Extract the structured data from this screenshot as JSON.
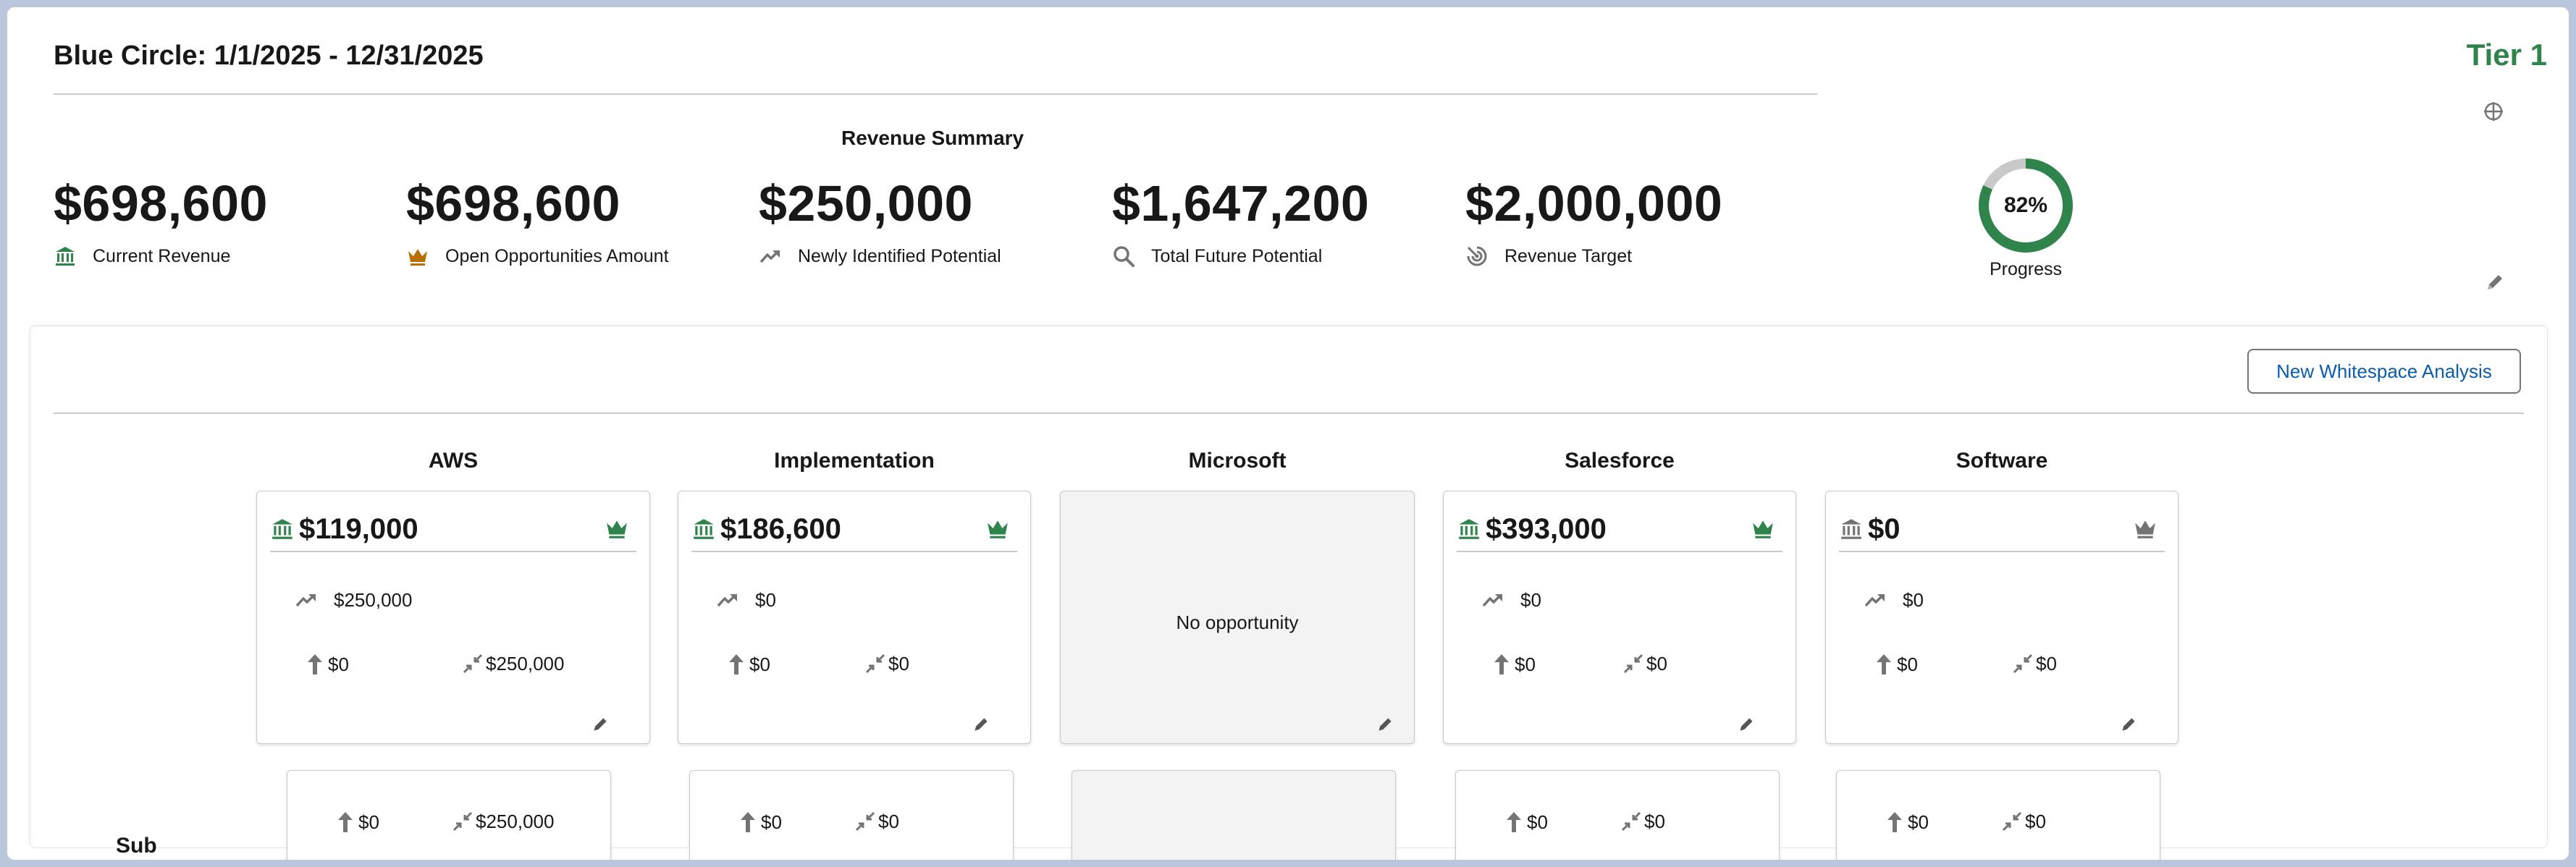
{
  "header": {
    "title": "Blue Circle: 1/1/2025 - 12/31/2025",
    "tier": "Tier 1"
  },
  "summary": {
    "heading": "Revenue Summary",
    "metrics": [
      {
        "amount": "$698,600",
        "label": "Current Revenue",
        "icon": "bank-icon"
      },
      {
        "amount": "$698,600",
        "label": "Open Opportunities Amount",
        "icon": "crown-icon"
      },
      {
        "amount": "$250,000",
        "label": "Newly Identified Potential",
        "icon": "trend-up-icon"
      },
      {
        "amount": "$1,647,200",
        "label": "Total Future Potential",
        "icon": "search-icon"
      },
      {
        "amount": "$2,000,000",
        "label": "Revenue Target",
        "icon": "target-icon"
      }
    ],
    "progress": {
      "percent_text": "82%",
      "value": 0.82,
      "label": "Progress"
    }
  },
  "whitespace": {
    "new_button": "New Whitespace Analysis",
    "columns": [
      {
        "title": "AWS",
        "revenue": "$119,000",
        "potential": "$250,000",
        "upsell": "$0",
        "cross": "$250,000",
        "has_opportunity": true,
        "row2_upsell": "$0",
        "row2_cross": "$250,000"
      },
      {
        "title": "Implementation",
        "revenue": "$186,600",
        "potential": "$0",
        "upsell": "$0",
        "cross": "$0",
        "has_opportunity": true,
        "row2_upsell": "$0",
        "row2_cross": "$0"
      },
      {
        "title": "Microsoft",
        "no_opportunity": "No opportunity",
        "has_opportunity": false
      },
      {
        "title": "Salesforce",
        "revenue": "$393,000",
        "potential": "$0",
        "upsell": "$0",
        "cross": "$0",
        "has_opportunity": true,
        "row2_upsell": "$0",
        "row2_cross": "$0"
      },
      {
        "title": "Software",
        "revenue": "$0",
        "potential": "$0",
        "upsell": "$0",
        "cross": "$0",
        "has_opportunity": true,
        "row2_upsell": "$0",
        "row2_cross": "$0"
      }
    ],
    "row_label": "Sub"
  },
  "colors": {
    "green": "#2e844a",
    "orange": "#b86e00",
    "link": "#0b5cab",
    "gray_icon": "#747474"
  }
}
